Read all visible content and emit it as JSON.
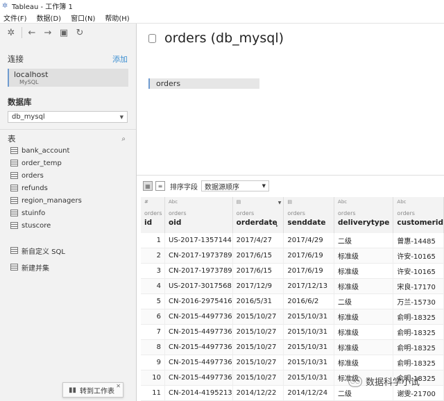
{
  "window": {
    "title": "Tableau - 工作簿 1"
  },
  "menu": [
    "文件(F)",
    "数据(D)",
    "窗口(N)",
    "帮助(H)"
  ],
  "sidebar": {
    "connections_label": "连接",
    "add_label": "添加",
    "connection": {
      "name": "localhost",
      "type": "MySQL"
    },
    "database_label": "数据库",
    "database_value": "db_mysql",
    "tables_label": "表",
    "tables": [
      "bank_account",
      "order_temp",
      "orders",
      "refunds",
      "region_managers",
      "stuinfo",
      "stuscore"
    ],
    "custom_sql": "新自定义 SQL",
    "new_union": "新建并集"
  },
  "goto_sheet": "转到工作表",
  "datasource_title": "orders (db_mysql)",
  "canvas_table": "orders",
  "grid_toolbar": {
    "sort_label": "排序字段",
    "sort_value": "数据源顺序"
  },
  "columns": [
    {
      "type": "#",
      "source": "orders",
      "name": "id"
    },
    {
      "type": "Abc",
      "source": "orders",
      "name": "oid"
    },
    {
      "type": "▤",
      "source": "orders",
      "name": "orderdate"
    },
    {
      "type": "▤",
      "source": "orders",
      "name": "senddate"
    },
    {
      "type": "Abc",
      "source": "orders",
      "name": "deliverytype"
    },
    {
      "type": "Abc",
      "source": "orders",
      "name": "customerid"
    }
  ],
  "rows": [
    [
      "1",
      "US-2017-1357144",
      "2017/4/27",
      "2017/4/29",
      "二级",
      "曾惠-14485"
    ],
    [
      "2",
      "CN-2017-1973789",
      "2017/6/15",
      "2017/6/19",
      "标准级",
      "许安-10165"
    ],
    [
      "3",
      "CN-2017-1973789",
      "2017/6/15",
      "2017/6/19",
      "标准级",
      "许安-10165"
    ],
    [
      "4",
      "US-2017-3017568",
      "2017/12/9",
      "2017/12/13",
      "标准级",
      "宋良-17170"
    ],
    [
      "5",
      "CN-2016-2975416",
      "2016/5/31",
      "2016/6/2",
      "二级",
      "万兰-15730"
    ],
    [
      "6",
      "CN-2015-4497736",
      "2015/10/27",
      "2015/10/31",
      "标准级",
      "俞明-18325"
    ],
    [
      "7",
      "CN-2015-4497736",
      "2015/10/27",
      "2015/10/31",
      "标准级",
      "俞明-18325"
    ],
    [
      "8",
      "CN-2015-4497736",
      "2015/10/27",
      "2015/10/31",
      "标准级",
      "俞明-18325"
    ],
    [
      "9",
      "CN-2015-4497736",
      "2015/10/27",
      "2015/10/31",
      "标准级",
      "俞明-18325"
    ],
    [
      "10",
      "CN-2015-4497736",
      "2015/10/27",
      "2015/10/31",
      "标准级",
      "俞明-18325"
    ],
    [
      "11",
      "CN-2014-4195213",
      "2014/12/22",
      "2014/12/24",
      "二级",
      "谢雯-21700"
    ]
  ],
  "watermark": "数据科学小试"
}
